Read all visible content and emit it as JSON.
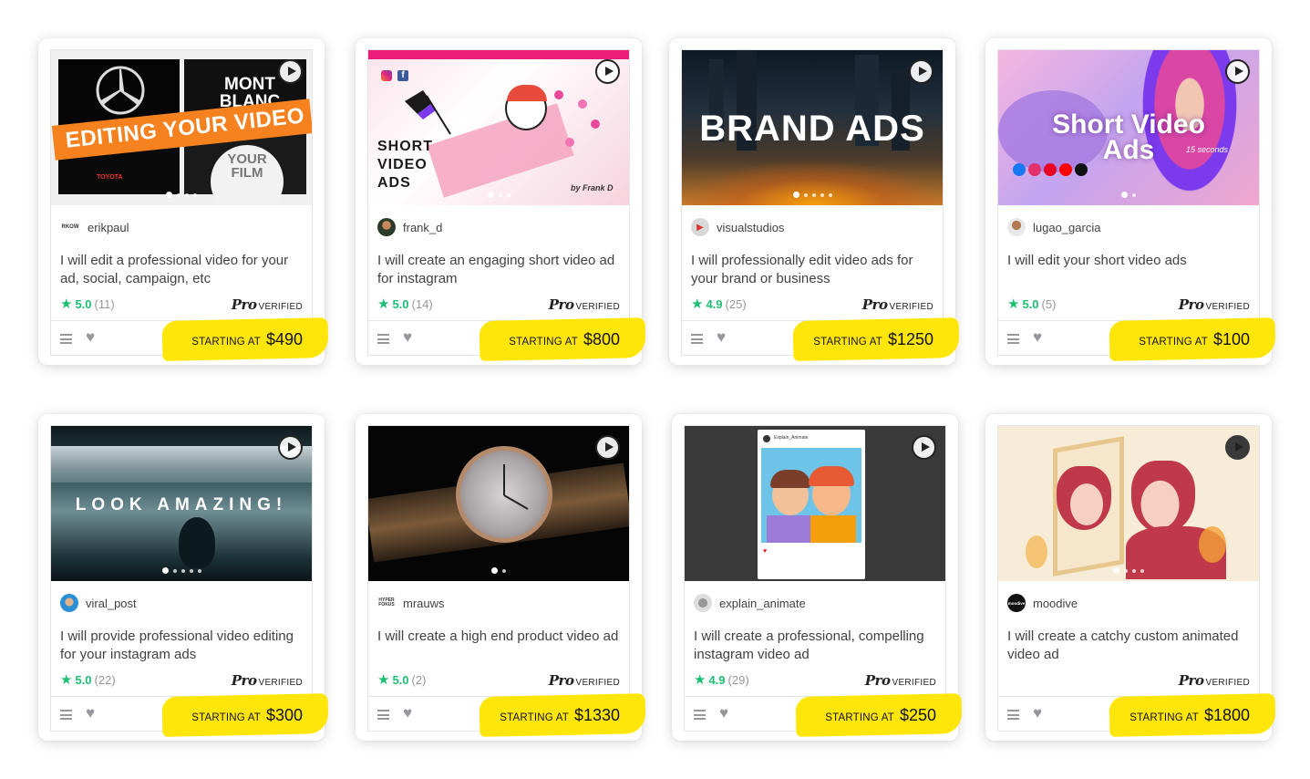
{
  "card_labels": {
    "pro_word": "Pro",
    "pro_verified": "VERIFIED",
    "starting_at": "STARTING AT"
  },
  "accent": {
    "rating_green": "#1dbf73",
    "highlight_yellow": "#ffe60a"
  },
  "icons": [
    "play-icon",
    "menu-icon",
    "heart-icon",
    "star-icon"
  ],
  "gigs": [
    {
      "seller": "erikpaul",
      "avatar_text": "RKOW",
      "title": "I will edit a professional video for your ad, social, campaign, etc",
      "rating": "5.0",
      "reviews": "(11)",
      "price": "$490",
      "thumb": {
        "banner": "EDITING YOUR VIDEO",
        "brand": "MONT BLANC",
        "sub": "YOUR FILM",
        "logo": "TOYOTA"
      },
      "slides": 4,
      "active_slide": 0
    },
    {
      "seller": "frank_d",
      "avatar_text": "",
      "title": "I will create an engaging short video ad for instagram",
      "rating": "5.0",
      "reviews": "(14)",
      "price": "$800",
      "thumb": {
        "headline": "SHORT VIDEO ADS",
        "signature": "by Frank D"
      },
      "slides": 3,
      "active_slide": 0
    },
    {
      "seller": "visualstudios",
      "avatar_text": "",
      "title": "I will professionally edit video ads for your brand or business",
      "rating": "4.9",
      "reviews": "(25)",
      "price": "$1250",
      "thumb": {
        "headline": "BRAND ADS"
      },
      "slides": 5,
      "active_slide": 0
    },
    {
      "seller": "lugao_garcia",
      "avatar_text": "",
      "title": "I will edit your short video ads",
      "rating": "5.0",
      "reviews": "(5)",
      "price": "$100",
      "thumb": {
        "headline": "Short Video Ads",
        "sub": "15 seconds"
      },
      "slides": 2,
      "active_slide": 0
    },
    {
      "seller": "viral_post",
      "avatar_text": "",
      "title": "I will provide professional video editing for your instagram ads",
      "rating": "5.0",
      "reviews": "(22)",
      "price": "$300",
      "thumb": {
        "headline": "LOOK AMAZING!"
      },
      "slides": 5,
      "active_slide": 0
    },
    {
      "seller": "mrauws",
      "avatar_text": "HYPER FOKUS",
      "title": "I will create a high end product video ad",
      "rating": "5.0",
      "reviews": "(2)",
      "price": "$1330",
      "thumb": {},
      "slides": 2,
      "active_slide": 0
    },
    {
      "seller": "explain_animate",
      "avatar_text": "",
      "title": "I will create a professional, compelling instagram video ad",
      "rating": "4.9",
      "reviews": "(29)",
      "price": "$250",
      "thumb": {
        "post_user": "Explain_Animate"
      },
      "slides": 1,
      "active_slide": 0
    },
    {
      "seller": "moodive",
      "avatar_text": "moodive",
      "title": "I will create a catchy custom animated video ad",
      "rating": "",
      "reviews": "",
      "price": "$1800",
      "thumb": {},
      "slides": 4,
      "active_slide": 0
    }
  ]
}
